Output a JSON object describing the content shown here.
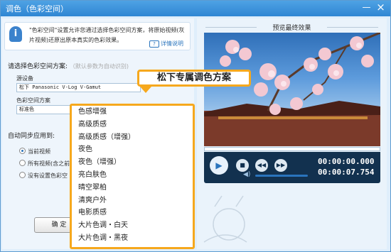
{
  "window": {
    "title": "调色（色彩空间）",
    "minimize_glyph": "—",
    "close_glyph": "×"
  },
  "info": {
    "icon": "info-icon",
    "text": "\"色彩空间\"设置允许您通过选择色彩空间方案，将原始视频(灰片视频)还原出原本真实的色彩效果。",
    "detail_link": "详情说明"
  },
  "scheme_section": {
    "title": "请选择色彩空间方案:",
    "hint": "（默认参数为自动识别)"
  },
  "source_device": {
    "label": "源设备",
    "value": "松下 Panasonic V-Log V-Gamut"
  },
  "color_space": {
    "label": "色彩空间方案",
    "value": "标准色"
  },
  "apply_section": {
    "title": "自动同步应用到:",
    "options": [
      {
        "label": "当前视频",
        "selected": true
      },
      {
        "label": "所有视频(含之前",
        "selected": false
      },
      {
        "label": "没有设置色彩空",
        "selected": false
      }
    ]
  },
  "ok_button": "确 定",
  "preview": {
    "title": "预览最终效果"
  },
  "player": {
    "play_icon": "play-icon",
    "stop_icon": "stop-icon",
    "prev_icon": "skip-back-icon",
    "next_icon": "skip-forward-icon",
    "volume_icon": "volume-icon",
    "current_time": "00:00:00.000",
    "total_time": "00:00:07.754"
  },
  "callout": {
    "label": "松下专属调色方案"
  },
  "dropdown": {
    "options": [
      "色感增强",
      "高级质感",
      "高级质感（增强）",
      "夜色",
      "夜色（增强）",
      "亮白肤色",
      "晴空翠柏",
      "清爽户外",
      "电影质感",
      "大片色调・白天",
      "大片色调・黑夜"
    ]
  },
  "colors": {
    "accent": "#f6a81d",
    "titlebar": "#2f86d3",
    "player_bg": "#12314f"
  }
}
